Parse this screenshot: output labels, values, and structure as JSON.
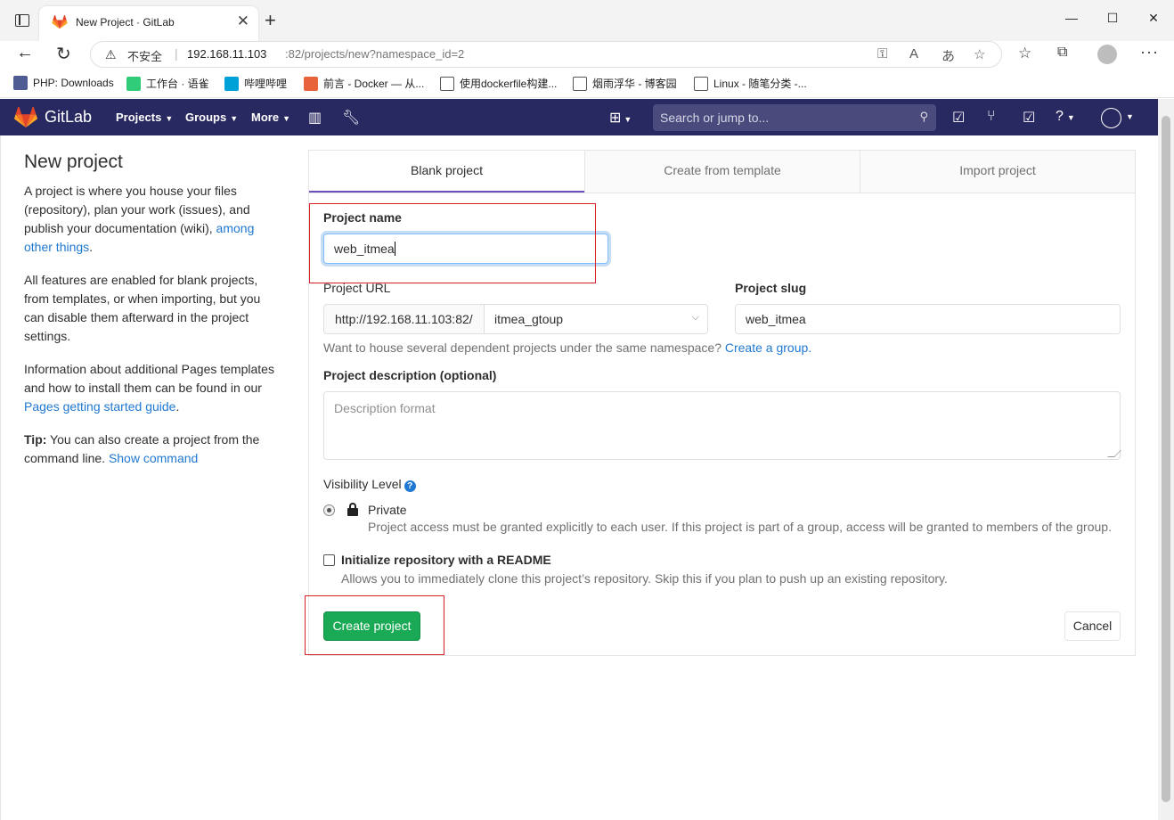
{
  "browser": {
    "tab_title": "New Project · GitLab",
    "tab_close": "✕",
    "new_tab": "+",
    "window_controls": [
      "—",
      "☐",
      "✕"
    ],
    "insecure_label": "不安全",
    "url_host": "192.168.11.103",
    "url_path": ":82/projects/new?namespace_id=2",
    "bookmarks": [
      {
        "label": "PHP: Downloads",
        "icon_color": "#4f5b93"
      },
      {
        "label": "工作台 · 语雀",
        "icon_color": "#31cc79"
      },
      {
        "label": "哔哩哔哩",
        "icon_color": "#00a1d6"
      },
      {
        "label": "前言 - Docker — 从...",
        "icon_color": "#e8623a"
      },
      {
        "label": "使用dockerfile构建...",
        "icon_color": "#555555"
      },
      {
        "label": "烟雨浮华 - 博客园",
        "icon_color": "#555555"
      },
      {
        "label": "Linux - 随笔分类 -...",
        "icon_color": "#555555"
      }
    ]
  },
  "gitlab_header": {
    "brand": "GitLab",
    "nav": [
      "Projects",
      "Groups",
      "More"
    ],
    "search_placeholder": "Search or jump to...",
    "header_color": "#292961"
  },
  "sidebar": {
    "title": "New project",
    "para1_text": "A project is where you house your files (repository), plan your work (issues), and publish your documentation (wiki),",
    "para1_link": "among other things",
    "para1_end": ".",
    "para2": "All features are enabled for blank projects, from templates, or when importing, but you can disable them afterward in the project settings.",
    "para3_text": "Information about additional Pages templates and how to install them can be found in our",
    "para3_link": "Pages getting started guide",
    "para3_end": ".",
    "tip_label": "Tip:",
    "tip_text": "You can also create a project from the command line.",
    "tip_link": "Show command"
  },
  "tabs": [
    "Blank project",
    "Create from template",
    "Import project"
  ],
  "form": {
    "project_name_label": "Project name",
    "project_name_value": "web_itmea",
    "project_url_label": "Project URL",
    "url_prefix": "http://192.168.11.103:82/",
    "namespace_value": "itmea_gtoup",
    "project_slug_label": "Project slug",
    "project_slug_value": "web_itmea",
    "namespace_help": "Want to house several dependent projects under the same namespace?",
    "namespace_help_link": "Create a group.",
    "description_label": "Project description (optional)",
    "description_placeholder": "Description format",
    "visibility_label": "Visibility Level",
    "private_label": "Private",
    "private_help": "Project access must be granted explicitly to each user. If this project is part of a group, access will be granted to members of the group.",
    "readme_label": "Initialize repository with a README",
    "readme_help": "Allows you to immediately clone this project’s repository. Skip this if you plan to push up an existing repository.",
    "create_button": "Create project",
    "cancel_button": "Cancel"
  },
  "colors": {
    "accent_link": "#1f78d1",
    "create_button": "#1aaa55",
    "annotation_red": "#d9212c",
    "active_tab_underline": "#6b4fbb"
  }
}
